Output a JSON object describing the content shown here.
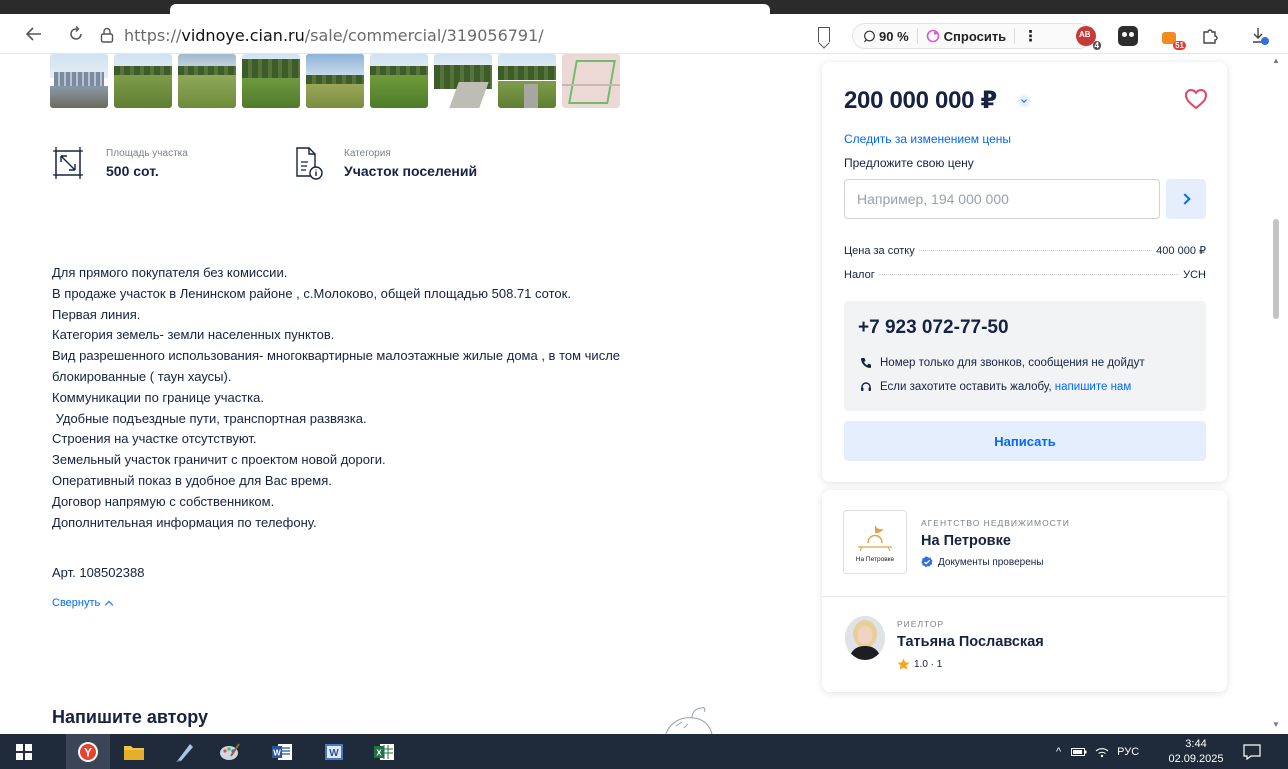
{
  "browser": {
    "url_prefix": "https://",
    "url_host": "vidnoye.cian.ru",
    "url_path": "/sale/commercial/319056791/",
    "zoom": "90 %",
    "ask_label": "Спросить"
  },
  "features": [
    {
      "icon": "area-icon",
      "label": "Площадь участка",
      "value": "500 сот."
    },
    {
      "icon": "document-info-icon",
      "label": "Категория",
      "value": "Участок поселений"
    }
  ],
  "description_lines": [
    "Для прямого покупателя без комиссии.",
    "В продаже участок в Ленинском районе , с.Молоково, общей площадью 508.71 соток.",
    "Первая линия.",
    "Категория земель- земли населенных пунктов.",
    "Вид разрешенного использования- многоквартирные малоэтажные жилые дома , в том числе",
    "блокированные ( таун хаусы).",
    "Коммуникации по границе участка.",
    " Удобные подъездные пути, транспортная развязка.",
    "Строения на участке отсутствуют.",
    "Земельный участок граничит с проектом новой дороги.",
    "Оперативный показ в удобное для Вас время.",
    "Договор напрямую с собственником.",
    "Дополнительная информация по телефону."
  ],
  "article": "Арт. 108502388",
  "collapse_label": "Свернуть",
  "write_author_title": "Напишите автору",
  "price_card": {
    "price": "200 000 000 ₽",
    "watch_price": "Следить за изменением цены",
    "offer_label": "Предложите свою цену",
    "offer_placeholder": "Например, 194 000 000",
    "rows": [
      {
        "key": "Цена за сотку",
        "value": "400 000 ₽"
      },
      {
        "key": "Налог",
        "value": "УСН"
      }
    ],
    "phone": "+7 923 072-77-50",
    "note_calls": "Номер только для звонков, сообщения не дойдут",
    "note_complaint": "Если захотите оставить жалобу,",
    "note_complaint_link": "напишите нам",
    "write_button": "Написать"
  },
  "agency": {
    "overline": "АГЕНТСТВО НЕДВИЖИМОСТИ",
    "name": "На Петровке",
    "logo_text": "На Петровке",
    "verified": "Документы проверены"
  },
  "realtor": {
    "overline": "РИЕЛТОР",
    "name": "Татьяна Пославская",
    "rating": "1.0 · 1"
  },
  "taskbar": {
    "lang": "РУС",
    "time": "3:44",
    "date": "02.09.2025"
  },
  "colors": {
    "accent": "#0468ff",
    "text": "#152242",
    "heart": "#e84260",
    "taskbar": "#1f2a3a"
  }
}
